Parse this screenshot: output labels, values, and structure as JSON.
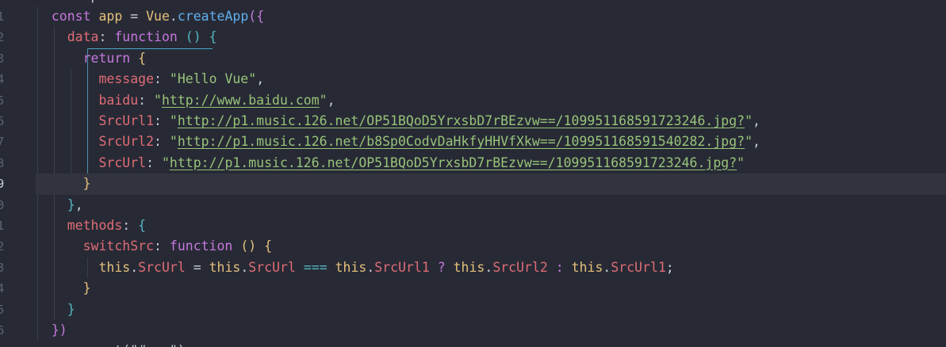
{
  "editor": {
    "line_numbers": [
      "1",
      "2",
      "3",
      "4",
      "5",
      "6",
      "7",
      "8",
      "9",
      "0",
      "1",
      "2",
      "3",
      "4",
      "5",
      "6"
    ],
    "active_line_index": 9,
    "top_partial": "<script>",
    "bottom_partial": "app.mount(\"#app\")",
    "lines": [
      [
        [
          "t",
          "  "
        ],
        [
          "k",
          "const"
        ],
        [
          "t",
          " "
        ],
        [
          "v",
          "app"
        ],
        [
          "t",
          " = "
        ],
        [
          "v",
          "Vue"
        ],
        [
          "t",
          "."
        ],
        [
          "f",
          "createApp"
        ],
        [
          "b1",
          "({"
        ]
      ],
      [
        [
          "t",
          "    "
        ],
        [
          "p",
          "data"
        ],
        [
          "t",
          ": "
        ],
        [
          "k",
          "function"
        ],
        [
          "t",
          " "
        ],
        [
          "b2",
          "()"
        ],
        [
          "t",
          " "
        ],
        [
          "b2",
          "{"
        ]
      ],
      [
        [
          "t",
          "      "
        ],
        [
          "k",
          "return"
        ],
        [
          "t",
          " "
        ],
        [
          "b3",
          "{"
        ]
      ],
      [
        [
          "t",
          "        "
        ],
        [
          "p",
          "message"
        ],
        [
          "t",
          ": "
        ],
        [
          "s",
          "\"Hello Vue\""
        ],
        [
          "t",
          ","
        ]
      ],
      [
        [
          "t",
          "        "
        ],
        [
          "p",
          "baidu"
        ],
        [
          "t",
          ": "
        ],
        [
          "s",
          "\""
        ],
        [
          "su",
          "http://www.baidu.com"
        ],
        [
          "s",
          "\""
        ],
        [
          "t",
          ","
        ]
      ],
      [
        [
          "t",
          "        "
        ],
        [
          "p",
          "SrcUrl1"
        ],
        [
          "t",
          ": "
        ],
        [
          "s",
          "\""
        ],
        [
          "su",
          "http://p1.music.126.net/OP51BQoD5YrxsbD7rBEzvw==/109951168591723246.jpg?"
        ],
        [
          "s",
          "\""
        ],
        [
          "t",
          ","
        ]
      ],
      [
        [
          "t",
          "        "
        ],
        [
          "p",
          "SrcUrl2"
        ],
        [
          "t",
          ": "
        ],
        [
          "s",
          "\""
        ],
        [
          "su",
          "http://p1.music.126.net/b8Sp0CodvDaHkfyHHVfXkw==/109951168591540282.jpg?"
        ],
        [
          "s",
          "\""
        ],
        [
          "t",
          ","
        ]
      ],
      [
        [
          "t",
          "        "
        ],
        [
          "p",
          "SrcUrl"
        ],
        [
          "t",
          ": "
        ],
        [
          "s",
          "\""
        ],
        [
          "su",
          "http://p1.music.126.net/OP51BQoD5YrxsbD7rBEzvw==/109951168591723246.jpg?"
        ],
        [
          "s",
          "\""
        ]
      ],
      [
        [
          "t",
          "      "
        ],
        [
          "b3",
          "}"
        ]
      ],
      [
        [
          "t",
          "    "
        ],
        [
          "b2",
          "}"
        ],
        [
          "t",
          ","
        ]
      ],
      [
        [
          "t",
          "    "
        ],
        [
          "p",
          "methods"
        ],
        [
          "t",
          ": "
        ],
        [
          "b2",
          "{"
        ]
      ],
      [
        [
          "t",
          "      "
        ],
        [
          "p",
          "switchSrc"
        ],
        [
          "t",
          ": "
        ],
        [
          "k",
          "function"
        ],
        [
          "t",
          " "
        ],
        [
          "b3",
          "()"
        ],
        [
          "t",
          " "
        ],
        [
          "b3",
          "{"
        ]
      ],
      [
        [
          "t",
          "        "
        ],
        [
          "v",
          "this"
        ],
        [
          "t",
          "."
        ],
        [
          "p",
          "SrcUrl"
        ],
        [
          "t",
          " = "
        ],
        [
          "v",
          "this"
        ],
        [
          "t",
          "."
        ],
        [
          "p",
          "SrcUrl"
        ],
        [
          "t",
          " "
        ],
        [
          "o",
          "==="
        ],
        [
          "t",
          " "
        ],
        [
          "v",
          "this"
        ],
        [
          "t",
          "."
        ],
        [
          "p",
          "SrcUrl1"
        ],
        [
          "t",
          " "
        ],
        [
          "k",
          "?"
        ],
        [
          "t",
          " "
        ],
        [
          "v",
          "this"
        ],
        [
          "t",
          "."
        ],
        [
          "p",
          "SrcUrl2"
        ],
        [
          "t",
          " "
        ],
        [
          "k",
          ":"
        ],
        [
          "t",
          " "
        ],
        [
          "v",
          "this"
        ],
        [
          "t",
          "."
        ],
        [
          "p",
          "SrcUrl1"
        ],
        [
          "t",
          ";"
        ]
      ],
      [
        [
          "t",
          "      "
        ],
        [
          "b3",
          "}"
        ]
      ],
      [
        [
          "t",
          "    "
        ],
        [
          "b2",
          "}"
        ]
      ],
      [
        [
          "t",
          "  "
        ],
        [
          "b1",
          "})"
        ]
      ]
    ]
  }
}
